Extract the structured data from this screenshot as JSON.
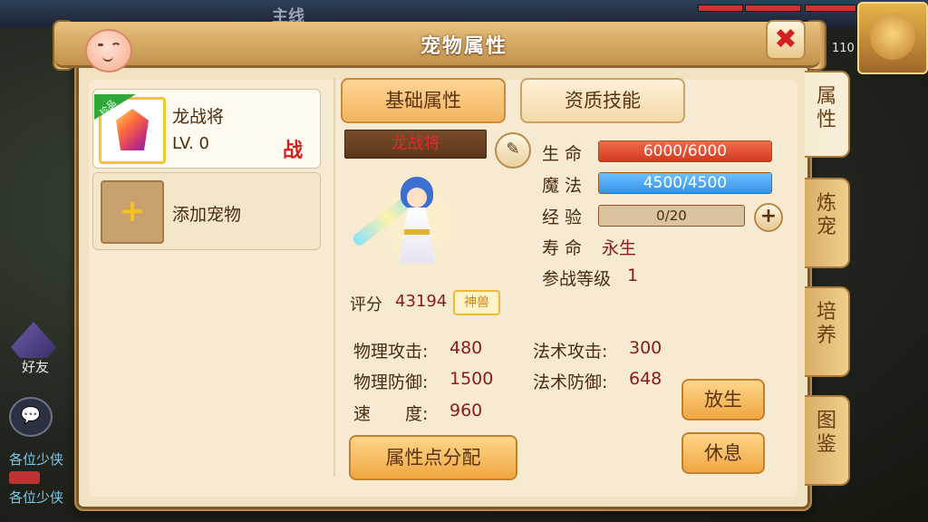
{
  "background": {
    "top_label": "主线",
    "corner_count": "110",
    "friends_label": "好友",
    "chat_lines": [
      "各位少侠",
      "各位少侠"
    ]
  },
  "dialog": {
    "title": "宠物属性",
    "close_glyph": "✖"
  },
  "side_tabs": [
    {
      "label": "属性",
      "active": true
    },
    {
      "label": "炼宠",
      "active": false
    },
    {
      "label": "培养",
      "active": false
    },
    {
      "label": "图鉴",
      "active": false
    }
  ],
  "pet_list": {
    "pet": {
      "name": "龙战将",
      "level": "LV. 0",
      "battle_mark": "战",
      "rarity_tag": "珍品"
    },
    "add_label": "添加宠物",
    "add_glyph": "+"
  },
  "tabs": {
    "basic": "基础属性",
    "skills": "资质技能"
  },
  "pet_detail": {
    "name_plate": "龙战将",
    "edit_glyph": "✎",
    "score_label": "评分",
    "score_value": "43194",
    "beast_tag": "神兽"
  },
  "stats": {
    "hp_label": "生 命",
    "hp_text": "6000/6000",
    "hp_fraction": 1.0,
    "mp_label": "魔 法",
    "mp_text": "4500/4500",
    "mp_fraction": 1.0,
    "xp_label": "经 验",
    "xp_text": "0/20",
    "xp_fraction": 0.0,
    "xp_plus": "+",
    "life_label": "寿 命",
    "life_value": "永生",
    "battle_level_label": "参战等级",
    "battle_level_value": "1"
  },
  "attributes": {
    "phys_atk_label": "物理攻击:",
    "phys_atk": "480",
    "phys_def_label": "物理防御:",
    "phys_def": "1500",
    "speed_label": "速　　度:",
    "speed": "960",
    "magic_atk_label": "法术攻击:",
    "magic_atk": "300",
    "magic_def_label": "法术防御:",
    "magic_def": "648"
  },
  "buttons": {
    "allocate": "属性点分配",
    "release": "放生",
    "rest": "休息"
  },
  "colors": {
    "accent": "#f0a641",
    "hp": "#d33a1f",
    "mp": "#3893e6",
    "value": "#8b1a1a"
  }
}
